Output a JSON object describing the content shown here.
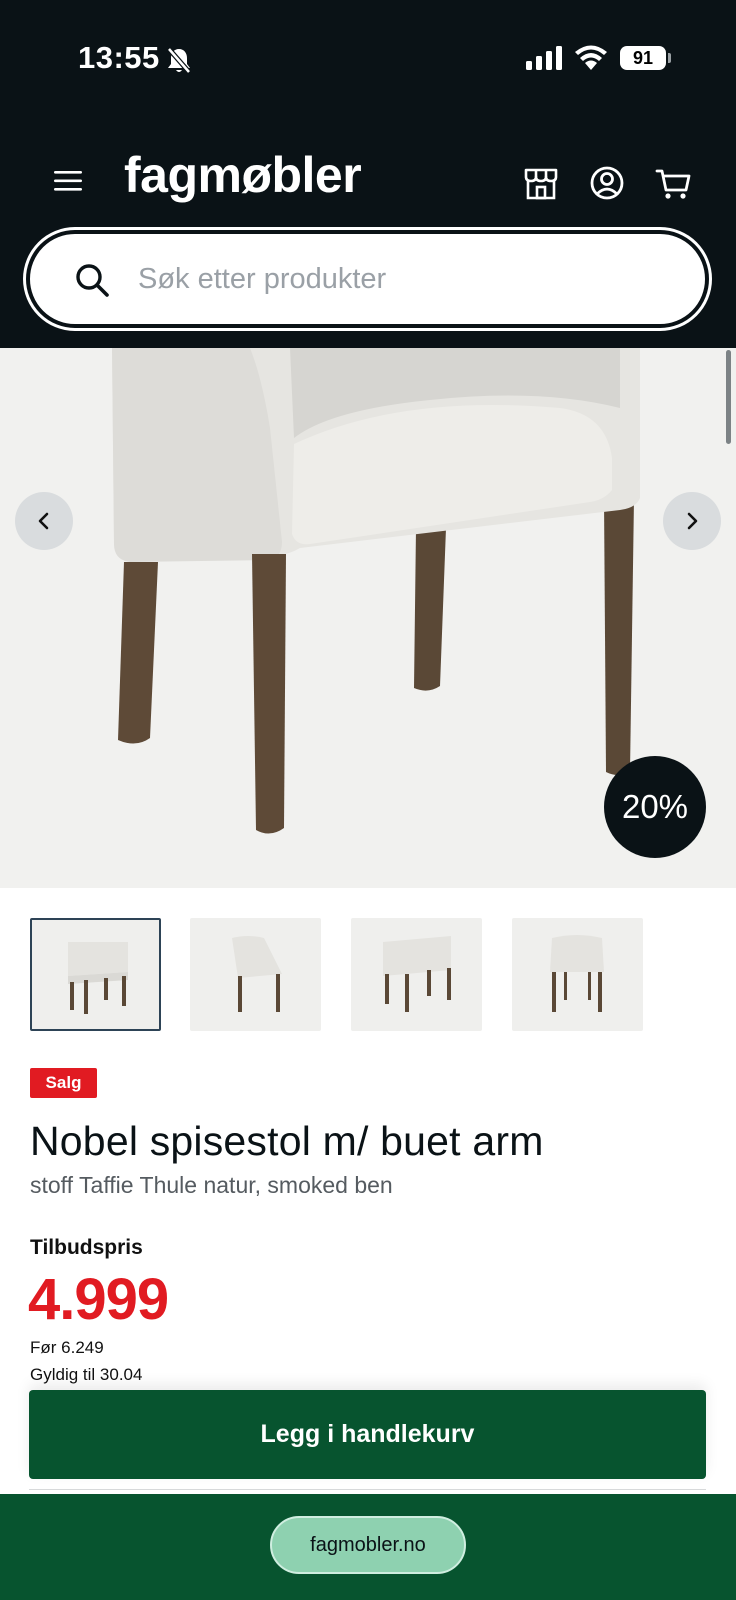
{
  "status_bar": {
    "time": "13:55",
    "battery": "91"
  },
  "header": {
    "logo": "fagmøbler"
  },
  "search": {
    "placeholder": "Søk etter produkter"
  },
  "hero": {
    "discount": "20%"
  },
  "product": {
    "badge": "Salg",
    "title": "Nobel spisestol m/ buet arm",
    "subtitle": "stoff Taffie Thule natur, smoked ben",
    "price_label": "Tilbudspris",
    "price": "4.999",
    "previous_price": "Før 6.249",
    "valid_until": "Gyldig til 30.04"
  },
  "cta": {
    "label": "Legg i handlekurv"
  },
  "browser": {
    "url": "fagmobler.no"
  },
  "colors": {
    "header_bg": "#0a1216",
    "sale_red": "#e11b22",
    "brand_green": "#07542f",
    "pill_green": "#8ed1b0"
  },
  "icons": [
    "bell-slash-icon",
    "signal-icon",
    "wifi-icon",
    "menu-icon",
    "store-icon",
    "account-icon",
    "cart-icon",
    "search-icon",
    "chevron-left-icon",
    "chevron-right-icon"
  ]
}
